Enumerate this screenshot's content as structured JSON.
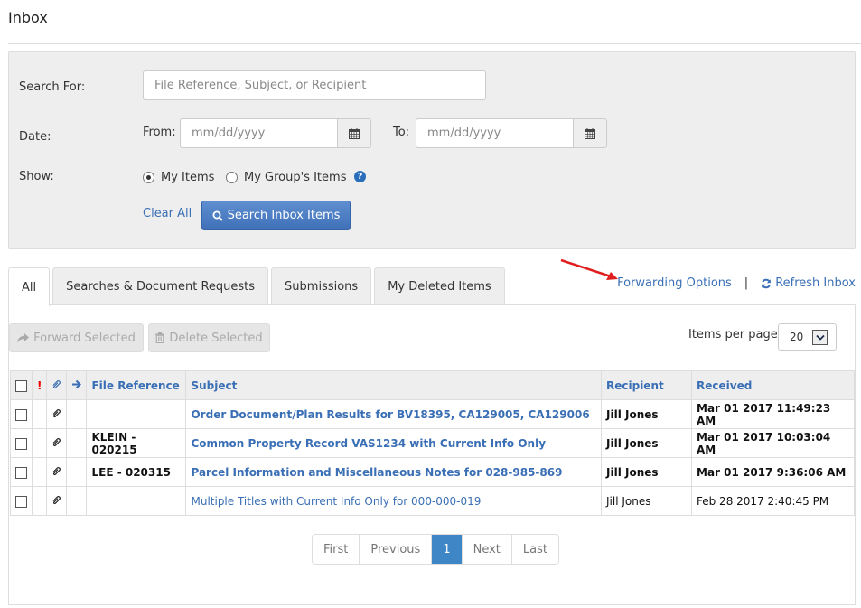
{
  "page": {
    "title": "Inbox"
  },
  "search": {
    "search_for_label": "Search For:",
    "search_placeholder": "File Reference, Subject, or Recipient",
    "search_value": "",
    "date_label": "Date:",
    "from_label": "From:",
    "from_placeholder": "mm/dd/yyyy",
    "to_label": "To:",
    "to_placeholder": "mm/dd/yyyy",
    "show_label": "Show:",
    "show_options": [
      {
        "label": "My Items",
        "selected": true
      },
      {
        "label": "My Group's Items",
        "selected": false
      }
    ],
    "help_icon": "question-circle-icon",
    "clear_all_label": "Clear All",
    "search_button_label": "Search Inbox Items",
    "search_button_icon": "search-icon"
  },
  "tabs": [
    {
      "label": "All",
      "active": true
    },
    {
      "label": "Searches & Document Requests",
      "active": false
    },
    {
      "label": "Submissions",
      "active": false
    },
    {
      "label": "My Deleted Items",
      "active": false
    }
  ],
  "top_links": {
    "forwarding_options": "Forwarding Options",
    "separator": "|",
    "refresh_inbox": "Refresh Inbox",
    "refresh_icon": "refresh-icon"
  },
  "annotation": {
    "arrow_color": "#e02020"
  },
  "actions": {
    "forward_selected": "Forward Selected",
    "delete_selected": "Delete Selected",
    "items_per_page_label": "Items per page",
    "items_per_page_value": "20"
  },
  "table": {
    "headers": {
      "important": "!",
      "attachment_icon": "paperclip-icon",
      "forward_icon": "arrow-right-icon",
      "file_reference": "File Reference",
      "subject": "Subject",
      "recipient": "Recipient",
      "received": "Received"
    },
    "rows": [
      {
        "unread": true,
        "file_reference": "",
        "subject": "Order Document/Plan Results for BV18395, CA129005, CA129006",
        "recipient": "Jill Jones",
        "received": "Mar 01 2017 11:49:23 AM"
      },
      {
        "unread": true,
        "file_reference": "KLEIN - 020215",
        "subject": "Common Property Record VAS1234 with Current Info Only",
        "recipient": "Jill Jones",
        "received": "Mar 01 2017 10:03:04 AM"
      },
      {
        "unread": true,
        "file_reference": "LEE - 020315",
        "subject": "Parcel Information and Miscellaneous Notes for 028-985-869",
        "recipient": "Jill Jones",
        "received": "Mar 01 2017 9:36:06 AM"
      },
      {
        "unread": false,
        "file_reference": "",
        "subject": "Multiple Titles with Current Info Only for 000-000-019",
        "recipient": "Jill Jones",
        "received": "Feb 28 2017 2:40:45 PM"
      }
    ]
  },
  "pagination": {
    "first": "First",
    "previous": "Previous",
    "current": "1",
    "next": "Next",
    "last": "Last"
  },
  "colors": {
    "link": "#3a6fb5",
    "primary_button": "#4a7cc2",
    "active_page": "#3f86c7",
    "important": "#e00000"
  }
}
